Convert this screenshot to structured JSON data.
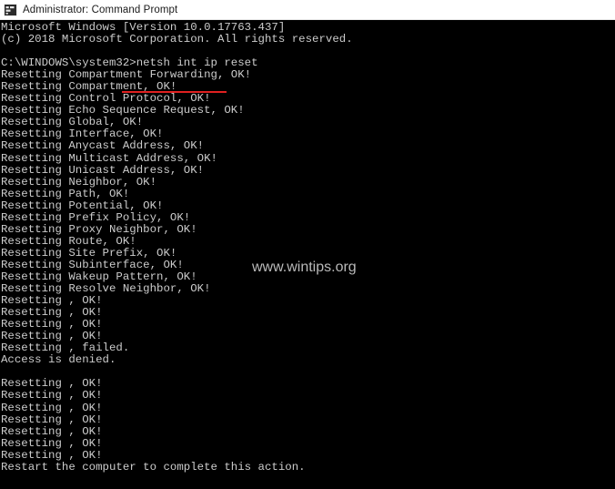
{
  "window": {
    "title": "Administrator: Command Prompt",
    "icon": "console-window-icon",
    "titlebar_bg": "#ffffff",
    "console_bg": "#000000",
    "console_fg": "#cccccc"
  },
  "annotation": {
    "underline_color": "#e02020",
    "underlines_text": "netsh int ip reset"
  },
  "watermark": {
    "text": "www.wintips.org",
    "color": "#b9b9b9"
  },
  "console": {
    "lines": [
      "Microsoft Windows [Version 10.0.17763.437]",
      "(c) 2018 Microsoft Corporation. All rights reserved.",
      "",
      "C:\\WINDOWS\\system32>netsh int ip reset",
      "Resetting Compartment Forwarding, OK!",
      "Resetting Compartment, OK!",
      "Resetting Control Protocol, OK!",
      "Resetting Echo Sequence Request, OK!",
      "Resetting Global, OK!",
      "Resetting Interface, OK!",
      "Resetting Anycast Address, OK!",
      "Resetting Multicast Address, OK!",
      "Resetting Unicast Address, OK!",
      "Resetting Neighbor, OK!",
      "Resetting Path, OK!",
      "Resetting Potential, OK!",
      "Resetting Prefix Policy, OK!",
      "Resetting Proxy Neighbor, OK!",
      "Resetting Route, OK!",
      "Resetting Site Prefix, OK!",
      "Resetting Subinterface, OK!",
      "Resetting Wakeup Pattern, OK!",
      "Resetting Resolve Neighbor, OK!",
      "Resetting , OK!",
      "Resetting , OK!",
      "Resetting , OK!",
      "Resetting , OK!",
      "Resetting , failed.",
      "Access is denied.",
      "",
      "Resetting , OK!",
      "Resetting , OK!",
      "Resetting , OK!",
      "Resetting , OK!",
      "Resetting , OK!",
      "Resetting , OK!",
      "Resetting , OK!",
      "Restart the computer to complete this action."
    ]
  }
}
